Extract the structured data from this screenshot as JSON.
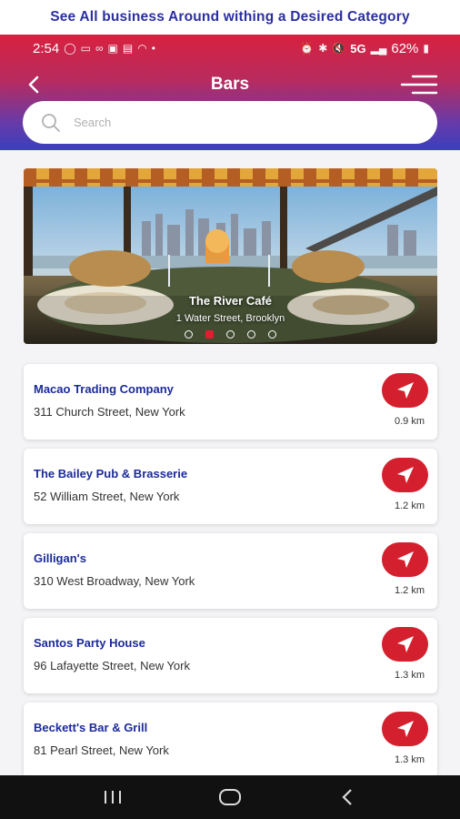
{
  "banner": {
    "text": "See All business Around withing a Desired Category"
  },
  "status": {
    "time": "2:54",
    "left_icons": [
      "whatsapp-icon",
      "message-icon",
      "voicemail-icon",
      "gallery-icon",
      "badge-icon",
      "wifi-icon",
      "dot-icon"
    ],
    "right_icons": [
      "alarm-icon",
      "bluetooth-icon",
      "mute-icon"
    ],
    "network": "5G",
    "battery": "62%"
  },
  "header": {
    "title": "Bars",
    "back_icon": "back-arrow-icon",
    "menu_icon": "hamburger-menu-icon"
  },
  "search": {
    "placeholder": "Search",
    "icon": "search-icon"
  },
  "hero": {
    "title": "The River Café",
    "subtitle": "1 Water Street, Brooklyn",
    "slide_count": 5,
    "active_slide": 1
  },
  "places": [
    {
      "name": "Macao Trading Company",
      "address": "311 Church Street, New York",
      "distance": "0.9 km"
    },
    {
      "name": "The Bailey Pub & Brasserie",
      "address": "52 William Street, New York",
      "distance": "1.2 km"
    },
    {
      "name": "Gilligan's",
      "address": "310 West Broadway, New York",
      "distance": "1.2 km"
    },
    {
      "name": "Santos Party House",
      "address": "96 Lafayette Street, New York",
      "distance": "1.3 km"
    },
    {
      "name": "Beckett's Bar & Grill",
      "address": "81 Pearl Street, New York",
      "distance": "1.3 km"
    }
  ],
  "colors": {
    "accent_red": "#d4202e",
    "header_top": "#d8213f",
    "header_bottom": "#3a3fbf",
    "name_blue": "#1b2a9a",
    "banner_blue": "#2b2fa0"
  },
  "system_nav": [
    "recents-icon",
    "home-icon",
    "back-icon"
  ]
}
